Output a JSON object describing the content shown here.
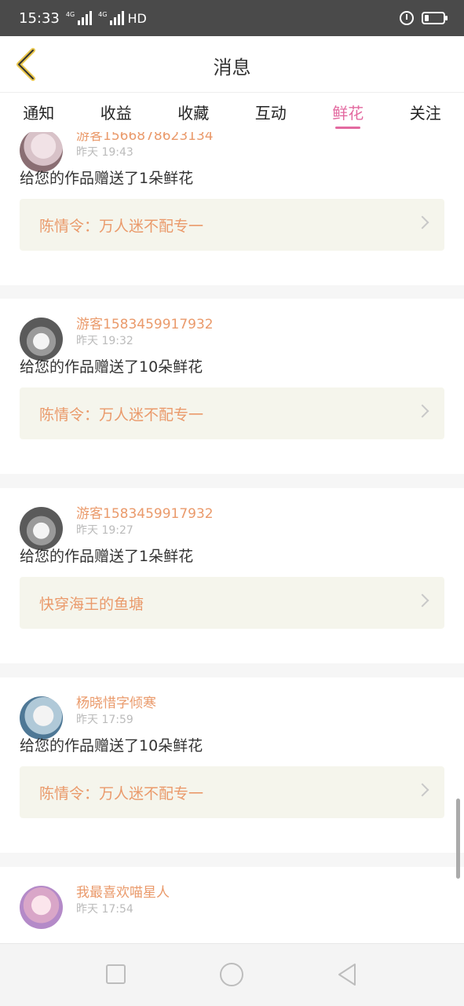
{
  "status_bar": {
    "time": "15:33",
    "network1": "4G",
    "network2": "4G",
    "hd": "HD"
  },
  "header": {
    "title": "消息",
    "back_icon": "chevron-left-icon"
  },
  "tabs": [
    {
      "label": "通知",
      "active": false
    },
    {
      "label": "收益",
      "active": false
    },
    {
      "label": "收藏",
      "active": false
    },
    {
      "label": "互动",
      "active": false
    },
    {
      "label": "鲜花",
      "active": true
    },
    {
      "label": "关注",
      "active": false
    }
  ],
  "messages": [
    {
      "user": "游客1566878623134",
      "time": "昨天 19:43",
      "text": "给您的作品赠送了1朵鲜花",
      "work": "陈情令：万人迷不配专一"
    },
    {
      "user": "游客1583459917932",
      "time": "昨天 19:32",
      "text": "给您的作品赠送了10朵鲜花",
      "work": "陈情令：万人迷不配专一"
    },
    {
      "user": "游客1583459917932",
      "time": "昨天 19:27",
      "text": "给您的作品赠送了1朵鲜花",
      "work": "快穿海王的鱼塘"
    },
    {
      "user": "杨晓惜字倾寒",
      "time": "昨天 17:59",
      "text": "给您的作品赠送了10朵鲜花",
      "work": "陈情令：万人迷不配专一"
    },
    {
      "user": "我最喜欢喵星人",
      "time": "昨天 17:54"
    }
  ],
  "colors": {
    "accent": "#e36aa0",
    "username": "#ea9a6b",
    "work_bg": "#f5f5ec"
  }
}
